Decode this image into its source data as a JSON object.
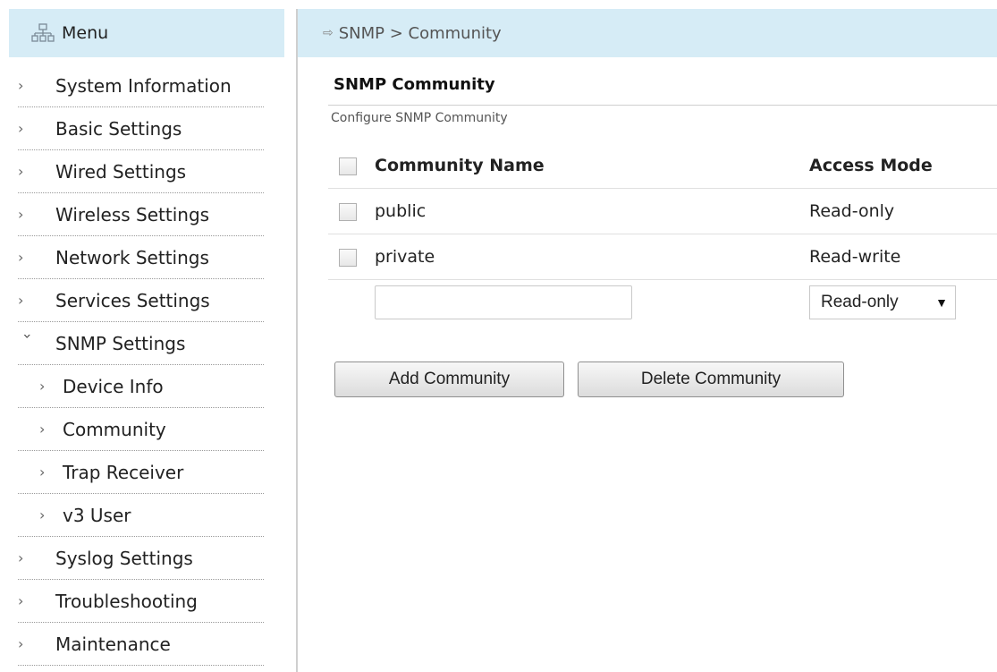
{
  "sidebar": {
    "title": "Menu",
    "items": [
      {
        "label": "System Information"
      },
      {
        "label": "Basic Settings"
      },
      {
        "label": "Wired Settings"
      },
      {
        "label": "Wireless Settings"
      },
      {
        "label": "Network Settings"
      },
      {
        "label": "Services Settings"
      },
      {
        "label": "SNMP Settings",
        "expanded": true
      },
      {
        "label": "Device Info",
        "sub": true
      },
      {
        "label": "Community",
        "sub": true
      },
      {
        "label": "Trap Receiver",
        "sub": true
      },
      {
        "label": "v3 User",
        "sub": true
      },
      {
        "label": "Syslog Settings"
      },
      {
        "label": "Troubleshooting"
      },
      {
        "label": "Maintenance"
      }
    ]
  },
  "breadcrumb": {
    "text": "SNMP > Community"
  },
  "section": {
    "title": "SNMP Community",
    "description": "Configure SNMP Community"
  },
  "table": {
    "headers": {
      "name": "Community Name",
      "mode": "Access Mode"
    },
    "rows": [
      {
        "name": "public",
        "mode": "Read-only"
      },
      {
        "name": "private",
        "mode": "Read-write"
      }
    ],
    "new_entry": {
      "name_value": "",
      "mode_selected": "Read-only"
    }
  },
  "buttons": {
    "add": "Add Community",
    "delete": "Delete Community"
  },
  "colors": {
    "header_bg": "#d6ecf6",
    "divider": "#cfcfcf"
  },
  "icons": {
    "menu": "sitemap-icon",
    "breadcrumb": "arrow-right-icon",
    "dropdown": "caret-down-icon"
  }
}
